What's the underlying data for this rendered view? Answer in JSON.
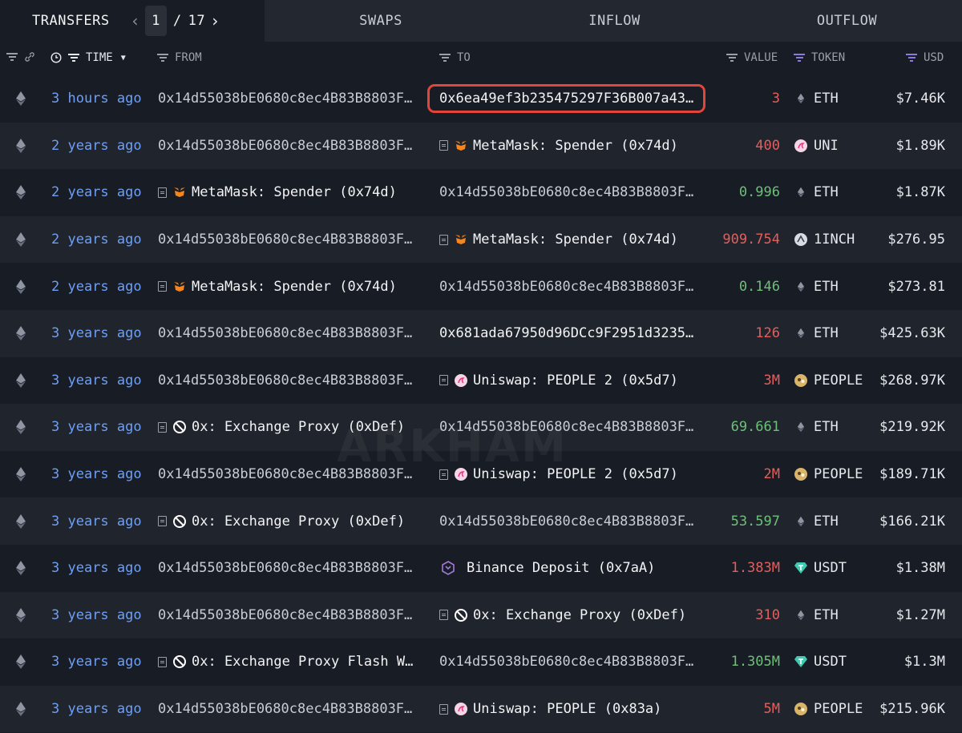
{
  "tabs": {
    "transfers": "TRANSFERS",
    "swaps": "SWAPS",
    "inflow": "INFLOW",
    "outflow": "OUTFLOW"
  },
  "pager": {
    "current": "1",
    "separator": "/",
    "total": "17"
  },
  "columns": {
    "time": "TIME",
    "from": "FROM",
    "to": "TO",
    "value": "VALUE",
    "token": "TOKEN",
    "usd": "USD"
  },
  "colors": {
    "outflow_value": "#e0605f",
    "inflow_value": "#6fbf7b",
    "time_link": "#6f9ff5",
    "highlight": "#e2453a"
  },
  "rows": [
    {
      "time": "3 hours ago",
      "from": "0x14d55038bE0680c8ec4B83B8803F…",
      "from_icon": "",
      "to": "0x6ea49ef3b235475297F36B007a43…",
      "to_icon": "",
      "value": "3",
      "dir": "out",
      "token": "ETH",
      "token_icon": "eth-icon",
      "usd": "$7.46K",
      "highlighted": true
    },
    {
      "time": "2 years ago",
      "from": "0x14d55038bE0680c8ec4B83B8803F…",
      "from_icon": "",
      "to": "MetaMask: Spender (0x74d)",
      "to_icon": "metamask-icon",
      "value": "400",
      "dir": "out",
      "token": "UNI",
      "token_icon": "uni-icon",
      "usd": "$1.89K"
    },
    {
      "time": "2 years ago",
      "from": "MetaMask: Spender (0x74d)",
      "from_icon": "metamask-icon",
      "to": "0x14d55038bE0680c8ec4B83B8803F…",
      "to_icon": "",
      "value": "0.996",
      "dir": "in",
      "token": "ETH",
      "token_icon": "eth-icon",
      "usd": "$1.87K"
    },
    {
      "time": "2 years ago",
      "from": "0x14d55038bE0680c8ec4B83B8803F…",
      "from_icon": "",
      "to": "MetaMask: Spender (0x74d)",
      "to_icon": "metamask-icon",
      "value": "909.754",
      "dir": "out",
      "token": "1INCH",
      "token_icon": "1inch-icon",
      "usd": "$276.95"
    },
    {
      "time": "2 years ago",
      "from": "MetaMask: Spender (0x74d)",
      "from_icon": "metamask-icon",
      "to": "0x14d55038bE0680c8ec4B83B8803F…",
      "to_icon": "",
      "value": "0.146",
      "dir": "in",
      "token": "ETH",
      "token_icon": "eth-icon",
      "usd": "$273.81"
    },
    {
      "time": "3 years ago",
      "from": "0x14d55038bE0680c8ec4B83B8803F…",
      "from_icon": "",
      "to": "0x681ada67950d96DCc9F2951d3235…",
      "to_icon": "",
      "value": "126",
      "dir": "out",
      "token": "ETH",
      "token_icon": "eth-icon",
      "usd": "$425.63K",
      "to_bright": true
    },
    {
      "time": "3 years ago",
      "from": "0x14d55038bE0680c8ec4B83B8803F…",
      "from_icon": "",
      "to": "Uniswap: PEOPLE 2 (0x5d7)",
      "to_icon": "uniswap-icon",
      "value": "3M",
      "dir": "out",
      "token": "PEOPLE",
      "token_icon": "people-icon",
      "usd": "$268.97K"
    },
    {
      "time": "3 years ago",
      "from": "0x: Exchange Proxy (0xDef)",
      "from_icon": "0x-icon",
      "to": "0x14d55038bE0680c8ec4B83B8803F…",
      "to_icon": "",
      "value": "69.661",
      "dir": "in",
      "token": "ETH",
      "token_icon": "eth-icon",
      "usd": "$219.92K"
    },
    {
      "time": "3 years ago",
      "from": "0x14d55038bE0680c8ec4B83B8803F…",
      "from_icon": "",
      "to": "Uniswap: PEOPLE 2 (0x5d7)",
      "to_icon": "uniswap-icon",
      "value": "2M",
      "dir": "out",
      "token": "PEOPLE",
      "token_icon": "people-icon",
      "usd": "$189.71K"
    },
    {
      "time": "3 years ago",
      "from": "0x: Exchange Proxy (0xDef)",
      "from_icon": "0x-icon",
      "to": "0x14d55038bE0680c8ec4B83B8803F…",
      "to_icon": "",
      "value": "53.597",
      "dir": "in",
      "token": "ETH",
      "token_icon": "eth-icon",
      "usd": "$166.21K"
    },
    {
      "time": "3 years ago",
      "from": "0x14d55038bE0680c8ec4B83B8803F…",
      "from_icon": "",
      "to": "Binance Deposit (0x7aA)",
      "to_icon": "binance-deposit-icon",
      "value": "1.383M",
      "dir": "out",
      "token": "USDT",
      "token_icon": "usdt-icon",
      "usd": "$1.38M"
    },
    {
      "time": "3 years ago",
      "from": "0x14d55038bE0680c8ec4B83B8803F…",
      "from_icon": "",
      "to": "0x: Exchange Proxy (0xDef)",
      "to_icon": "0x-icon",
      "value": "310",
      "dir": "out",
      "token": "ETH",
      "token_icon": "eth-icon",
      "usd": "$1.27M"
    },
    {
      "time": "3 years ago",
      "from": "0x: Exchange Proxy Flash W…",
      "from_icon": "0x-icon",
      "to": "0x14d55038bE0680c8ec4B83B8803F…",
      "to_icon": "",
      "value": "1.305M",
      "dir": "in",
      "token": "USDT",
      "token_icon": "usdt-icon",
      "usd": "$1.3M"
    },
    {
      "time": "3 years ago",
      "from": "0x14d55038bE0680c8ec4B83B8803F…",
      "from_icon": "",
      "to": "Uniswap: PEOPLE (0x83a)",
      "to_icon": "uniswap-icon",
      "value": "5M",
      "dir": "out",
      "token": "PEOPLE",
      "token_icon": "people-icon",
      "usd": "$215.96K"
    }
  ]
}
